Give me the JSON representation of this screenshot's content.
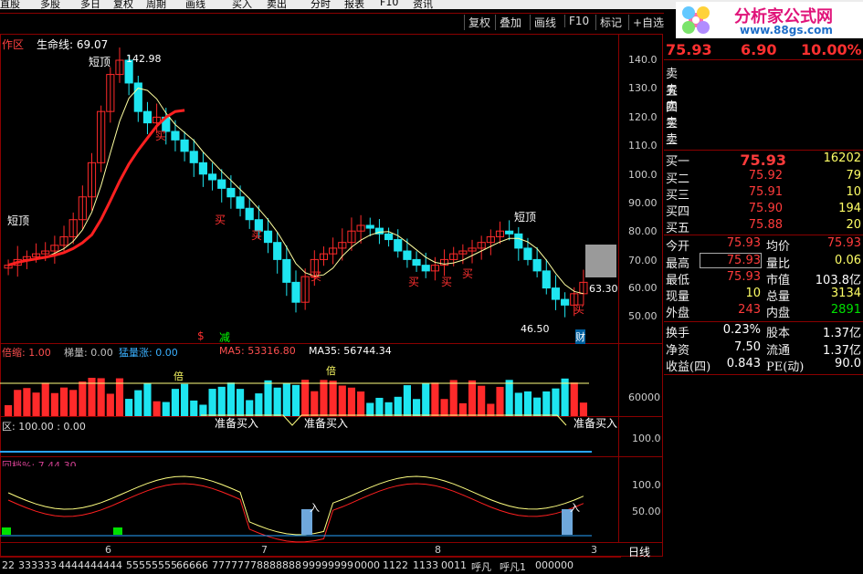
{
  "menu": [
    "直股",
    "多股",
    "多日",
    "复权",
    "周期",
    "画线",
    "买入",
    "卖出",
    "分时",
    "报表",
    "F10",
    "资讯"
  ],
  "toolbar": {
    "buttons": [
      "复权",
      "叠加",
      "画线",
      "F10",
      "标记",
      "+自选"
    ]
  },
  "logo": {
    "name": "分析家公式网",
    "url": "www.88gs.com"
  },
  "main_panel": {
    "title": "作区",
    "life_line_label": "生命线: 69.07",
    "y_ticks": [
      "140.0",
      "130.0",
      "120.0",
      "110.0",
      "100.0",
      "90.00",
      "80.00",
      "70.00",
      "60.00",
      "50.00"
    ],
    "annotations": {
      "short_top_1": "短顶",
      "short_top_2": "短顶",
      "short_top_3": "短顶",
      "high_price": "142.98",
      "low_price": "46.50",
      "last_price": "63.30",
      "buy": "买",
      "reduce": "减",
      "dollar": "$",
      "ebb": "倍",
      "finance": "财"
    }
  },
  "volume_panel": {
    "ratio_label": "倍缩: 1.00",
    "flat_label": "梯量: 0.00",
    "sharp_label": "猛量涨: 0.00",
    "ma5_label": "MA5: 53316.80",
    "ma35_label": "MA35: 56744.34",
    "y_tick": "60000"
  },
  "signal_panel": {
    "title": "区: 100.00 : 0.00",
    "y_tick": "100.0",
    "labels": [
      "准备买入",
      "准备买入",
      "准备买入"
    ]
  },
  "osc_panel": {
    "title": "回档%: 7 44.30",
    "y_ticks": [
      "100.0",
      "50.00"
    ],
    "entry_labels": [
      "入",
      "入"
    ]
  },
  "x_axis": {
    "labels": [
      "6",
      "7",
      "8",
      "3"
    ],
    "period": "日线"
  },
  "bottom_tabs": [
    "22",
    "333333",
    "4444444444",
    "55555555",
    "66666",
    "7777777",
    "8888888",
    "99999999",
    "0000",
    "1122",
    "1133",
    "0011",
    "呼凡",
    "呼凡1",
    "000000"
  ],
  "quote": {
    "price_header": [
      "75.93",
      "6.90",
      "10.00%"
    ],
    "sell": [
      {
        "label": "卖五",
        "price": "",
        "vol": ""
      },
      {
        "label": "卖四",
        "price": "",
        "vol": ""
      },
      {
        "label": "卖三",
        "price": "",
        "vol": ""
      },
      {
        "label": "卖二",
        "price": "",
        "vol": ""
      },
      {
        "label": "卖一",
        "price": "",
        "vol": ""
      }
    ],
    "buy": [
      {
        "label": "买一",
        "price": "75.93",
        "vol": "16202"
      },
      {
        "label": "买二",
        "price": "75.92",
        "vol": "79"
      },
      {
        "label": "买三",
        "price": "75.91",
        "vol": "10"
      },
      {
        "label": "买四",
        "price": "75.90",
        "vol": "194"
      },
      {
        "label": "买五",
        "price": "75.88",
        "vol": "20"
      }
    ],
    "stats": [
      {
        "l1": "今开",
        "v1": "75.93",
        "l2": "均价",
        "v2": "75.93"
      },
      {
        "l1": "最高",
        "v1": "75.93",
        "l2": "量比",
        "v2": "0.06"
      },
      {
        "l1": "最低",
        "v1": "75.93",
        "l2": "市值",
        "v2": "103.8亿"
      },
      {
        "l1": "现量",
        "v1": "10",
        "l2": "总量",
        "v2": "3134"
      },
      {
        "l1": "外盘",
        "v1": "243",
        "l2": "内盘",
        "v2": "2891"
      }
    ],
    "fund": [
      {
        "l1": "换手",
        "v1": "0.23%",
        "l2": "股本",
        "v2": "1.37亿"
      },
      {
        "l1": "净资",
        "v1": "7.50",
        "l2": "流通",
        "v2": "1.37亿"
      },
      {
        "l1": "收益(四)",
        "v1": "0.843",
        "l2": "PE(动)",
        "v2": "90.0"
      }
    ]
  },
  "colors": {
    "up": "#ff2a2a",
    "down": "#00e5ff",
    "ma_white": "#ffffff",
    "ma_red": "#ff2020",
    "ma_yellow": "#ffff80",
    "grid": "#8b0000"
  }
}
